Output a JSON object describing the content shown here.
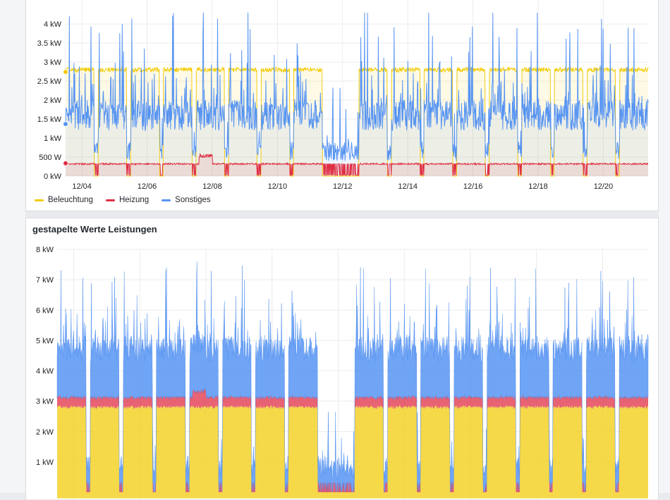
{
  "colors": {
    "beleuchtung": "#f2cc0c",
    "heizung": "#e02f44",
    "sonstiges": "#5794f2",
    "grid": "#ececec"
  },
  "chart_data": [
    {
      "type": "line",
      "title": "",
      "x_range": [
        "12/03 12:00",
        "12/21 09:00"
      ],
      "x_ticks": [
        "12/04",
        "12/06",
        "12/08",
        "12/10",
        "12/12",
        "12/14",
        "12/16",
        "12/18",
        "12/20"
      ],
      "y_unit": "kW",
      "y_ticks": [
        "0 kW",
        "500 W",
        "1 kW",
        "1.5 kW",
        "2 kW",
        "2.5 kW",
        "3 kW",
        "3.5 kW",
        "4 kW"
      ],
      "ylim": [
        0,
        4.3
      ],
      "grid": true,
      "legend_placement": "bottom-left",
      "legend": [
        "Beleuchtung",
        "Heizung",
        "Sonstiges"
      ],
      "series": [
        {
          "name": "Beleuchtung",
          "color": "#f2cc0c",
          "on_level_kw": 2.8,
          "off_level_kw": 0.0,
          "on_periods": [
            [
              "12/03 12:00",
              "12/04 09:00"
            ],
            [
              "12/04 12:00",
              "12/05 09:00"
            ],
            [
              "12/05 12:00",
              "12/06 09:00"
            ],
            [
              "12/06 12:00",
              "12/07 09:00"
            ],
            [
              "12/07 12:00",
              "12/08 09:00"
            ],
            [
              "12/08 12:00",
              "12/09 09:00"
            ],
            [
              "12/09 12:00",
              "12/10 09:00"
            ],
            [
              "12/10 12:00",
              "12/11 09:00"
            ],
            [
              "12/12 12:00",
              "12/13 09:00"
            ],
            [
              "12/13 12:00",
              "12/14 09:00"
            ],
            [
              "12/14 12:00",
              "12/15 09:00"
            ],
            [
              "12/15 12:00",
              "12/16 09:00"
            ],
            [
              "12/16 12:00",
              "12/17 09:00"
            ],
            [
              "12/17 12:00",
              "12/18 09:00"
            ],
            [
              "12/18 12:00",
              "12/19 09:00"
            ],
            [
              "12/19 12:00",
              "12/20 09:00"
            ],
            [
              "12/20 12:00",
              "12/21 09:00"
            ]
          ]
        },
        {
          "name": "Heizung",
          "color": "#e02f44",
          "typical_kw": 0.32,
          "min_kw": 0.0,
          "max_kw": 0.58
        },
        {
          "name": "Sonstiges",
          "color": "#5794f2",
          "typical_kw": 1.2,
          "peak_kw": 4.3,
          "night_low_kw": 0.4
        }
      ]
    },
    {
      "type": "area",
      "stacked": true,
      "title": "gestapelte Werte Leistungen",
      "x_range": [
        "12/03 12:00",
        "12/21 09:00"
      ],
      "y_unit": "kW",
      "y_ticks": [
        "1 kW",
        "2 kW",
        "3 kW",
        "4 kW",
        "5 kW",
        "6 kW",
        "7 kW",
        "8 kW"
      ],
      "ylim": [
        0,
        8
      ],
      "grid": true,
      "series": [
        {
          "name": "Beleuchtung",
          "color": "#f2cc0c",
          "on_level_kw": 2.8
        },
        {
          "name": "Heizung",
          "color": "#e02f44",
          "typical_kw": 0.32
        },
        {
          "name": "Sonstiges",
          "color": "#5794f2",
          "typical_kw": 1.2,
          "peak_total_kw": 7.2
        }
      ]
    }
  ]
}
